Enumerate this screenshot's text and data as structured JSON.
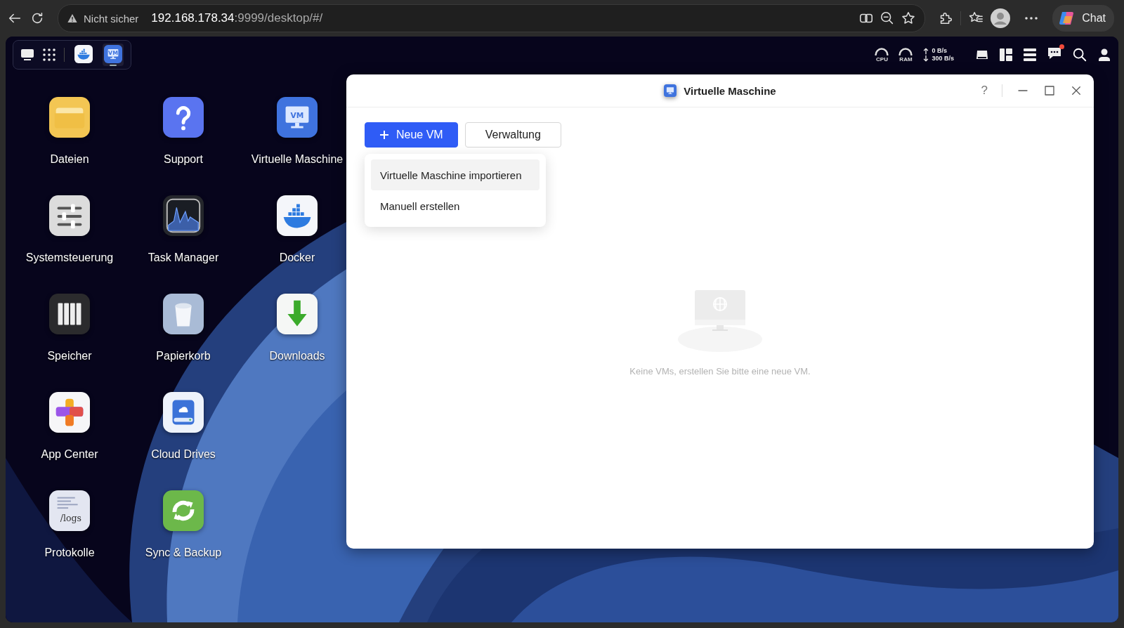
{
  "browser": {
    "security_label": "Nicht sicher",
    "url_host": "192.168.178.34",
    "url_rest": ":9999/desktop/#/",
    "chat_label": "Chat"
  },
  "dock": {
    "apps": [
      {
        "kind": "docker",
        "selected": false
      },
      {
        "kind": "vm",
        "selected": true,
        "icon_text": "VM"
      }
    ]
  },
  "tray": {
    "cpu_label": "CPU",
    "ram_label": "RAM",
    "upload": "0 B/s",
    "download": "300 B/s",
    "notification": true
  },
  "desktop_icons": [
    {
      "kind": "files",
      "label": "Dateien"
    },
    {
      "kind": "settings",
      "label": "Systemsteuerung"
    },
    {
      "kind": "storage",
      "label": "Speicher"
    },
    {
      "kind": "appcenter",
      "label": "App Center"
    },
    {
      "kind": "logs",
      "label": "Protokolle",
      "icon_text": "/logs"
    },
    {
      "kind": "support",
      "label": "Support"
    },
    {
      "kind": "taskmanager",
      "label": "Task Manager"
    },
    {
      "kind": "trash",
      "label": "Papierkorb"
    },
    {
      "kind": "clouddrives",
      "label": "Cloud Drives"
    },
    {
      "kind": "sync",
      "label": "Sync & Backup"
    },
    {
      "kind": "vm",
      "label": "Virtuelle Maschine",
      "icon_text": "VM"
    },
    {
      "kind": "docker",
      "label": "Docker"
    },
    {
      "kind": "downloads",
      "label": "Downloads"
    }
  ],
  "window": {
    "title": "Virtuelle Maschine",
    "help": "?",
    "buttons": [
      {
        "kind": "primary",
        "label": "Neue VM"
      },
      {
        "kind": "secondary",
        "label": "Verwaltung"
      }
    ],
    "menu": [
      {
        "label": "Virtuelle Maschine importieren",
        "selected": true
      },
      {
        "label": "Manuell erstellen",
        "selected": false
      }
    ],
    "empty_text": "Keine VMs, erstellen Sie bitte eine neue VM."
  }
}
